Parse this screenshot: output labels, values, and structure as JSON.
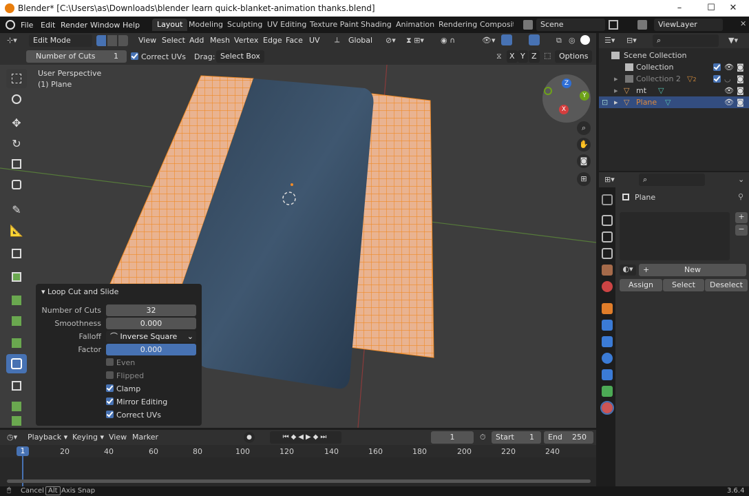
{
  "window": {
    "title": "Blender* [C:\\Users\\as\\Downloads\\blender learn quick-blanket-animation thanks.blend]",
    "minimize": "–",
    "maximize": "☐",
    "close": "✕"
  },
  "menubar": {
    "items": [
      "File",
      "Edit",
      "Render",
      "Window",
      "Help"
    ]
  },
  "workspaces": [
    "Layout",
    "Modeling",
    "Sculpting",
    "UV Editing",
    "Texture Paint",
    "Shading",
    "Animation",
    "Rendering",
    "Compositir"
  ],
  "scene": {
    "name": "Scene",
    "view_layer": "ViewLayer"
  },
  "viewport_header": {
    "mode": "Edit Mode",
    "menus": [
      "View",
      "Select",
      "Add",
      "Mesh",
      "Vertex",
      "Edge",
      "Face",
      "UV"
    ],
    "orientation": "Global"
  },
  "tool_options": {
    "number_of_cuts_label": "Number of Cuts",
    "number_of_cuts_value": "1",
    "correct_uvs": "Correct UVs",
    "drag_label": "Drag:",
    "drag_value": "Select Box",
    "axes": [
      "X",
      "Y",
      "Z"
    ],
    "options": "Options"
  },
  "viewport": {
    "perspective": "User Perspective",
    "object": "(1) Plane",
    "gizmo": {
      "z": "Z",
      "y": "Y",
      "x": "X"
    }
  },
  "redo_panel": {
    "title": "Loop Cut and Slide",
    "fields": [
      {
        "label": "Number of Cuts",
        "value": "32"
      },
      {
        "label": "Smoothness",
        "value": "0.000"
      },
      {
        "label": "Falloff",
        "value": "Inverse Square"
      },
      {
        "label": "Factor",
        "value": "0.000"
      }
    ],
    "checks": [
      {
        "label": "Even",
        "on": false
      },
      {
        "label": "Flipped",
        "on": false
      },
      {
        "label": "Clamp",
        "on": true
      },
      {
        "label": "Mirror Editing",
        "on": true
      },
      {
        "label": "Correct UVs",
        "on": true
      }
    ]
  },
  "timeline": {
    "menus": [
      "Playback",
      "Keying",
      "View",
      "Marker"
    ],
    "current": "1",
    "start_label": "Start",
    "start": "1",
    "end_label": "End",
    "end": "250",
    "current_frame": "1",
    "ticks": [
      "20",
      "40",
      "60",
      "80",
      "100",
      "120",
      "140",
      "160",
      "180",
      "200",
      "220",
      "240"
    ]
  },
  "statusbar": {
    "cancel": "Cancel",
    "alt": "Alt",
    "axis_snap": "Axis Snap",
    "version": "3.6.4"
  },
  "outliner": {
    "rows": [
      {
        "label": "Scene Collection"
      },
      {
        "label": "Collection"
      },
      {
        "label": "Collection 2",
        "badge": "2"
      },
      {
        "label": "mt"
      },
      {
        "label": "Plane"
      }
    ]
  },
  "properties": {
    "object": "Plane",
    "new": "New",
    "assign": "Assign",
    "select": "Select",
    "deselect": "Deselect",
    "plus": "+",
    "minus": "−"
  },
  "colors": {
    "accent": "#4772b3",
    "selected_row": "#334d80",
    "mesh_orange": "#f08b27",
    "mesh_face": "#f0ae7c"
  }
}
